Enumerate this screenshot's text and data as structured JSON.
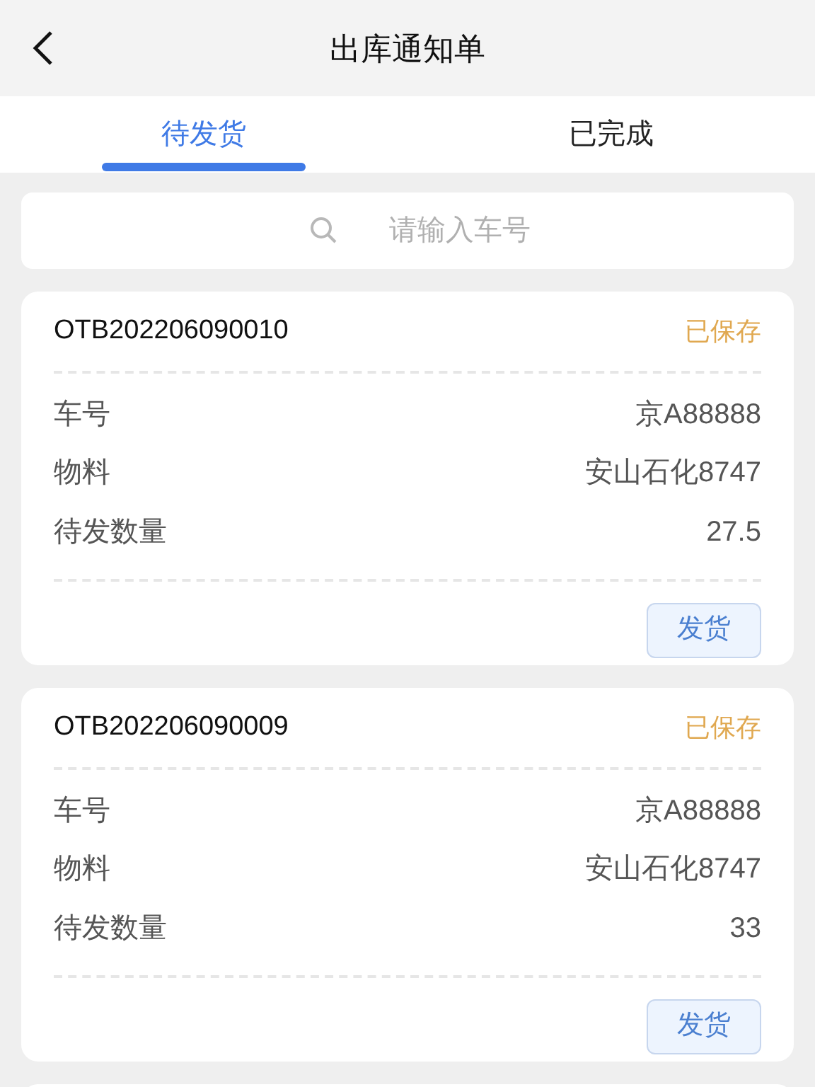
{
  "header": {
    "title": "出库通知单"
  },
  "tabs": [
    {
      "label": "待发货",
      "selected": true
    },
    {
      "label": "已完成",
      "selected": false
    }
  ],
  "search": {
    "placeholder": "请输入车号"
  },
  "orders": [
    {
      "number": "OTB202206090010",
      "status": "已保存",
      "fields": [
        {
          "label": "车号",
          "value": "京A88888"
        },
        {
          "label": "物料",
          "value": "安山石化8747"
        },
        {
          "label": "待发数量",
          "value": "27.5"
        }
      ],
      "action": "发货"
    },
    {
      "number": "OTB202206090009",
      "status": "已保存",
      "fields": [
        {
          "label": "车号",
          "value": "京A88888"
        },
        {
          "label": "物料",
          "value": "安山石化8747"
        },
        {
          "label": "待发数量",
          "value": "33"
        }
      ],
      "action": "发货"
    }
  ]
}
